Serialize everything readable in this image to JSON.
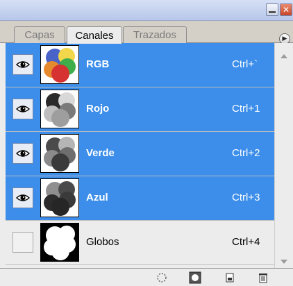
{
  "tabs": [
    {
      "label": "Capas",
      "active": false
    },
    {
      "label": "Canales",
      "active": true
    },
    {
      "label": "Trazados",
      "active": false
    }
  ],
  "channels": [
    {
      "name": "RGB",
      "shortcut": "Ctrl+`",
      "visible": true,
      "selected": true,
      "thumbnail": "color-balloons"
    },
    {
      "name": "Rojo",
      "shortcut": "Ctrl+1",
      "visible": true,
      "selected": true,
      "thumbnail": "gray-balloons-light"
    },
    {
      "name": "Verde",
      "shortcut": "Ctrl+2",
      "visible": true,
      "selected": true,
      "thumbnail": "gray-balloons-mid"
    },
    {
      "name": "Azul",
      "shortcut": "Ctrl+3",
      "visible": true,
      "selected": true,
      "thumbnail": "gray-balloons-dark"
    },
    {
      "name": "Globos",
      "shortcut": "Ctrl+4",
      "visible": false,
      "selected": false,
      "thumbnail": "white-mask"
    }
  ],
  "toolbar_icons": [
    "dotted-circle-icon",
    "mask-circle-icon",
    "new-channel-icon",
    "trash-icon"
  ],
  "colors": {
    "selection": "#3c8eea",
    "panel_bg": "#ececec"
  }
}
